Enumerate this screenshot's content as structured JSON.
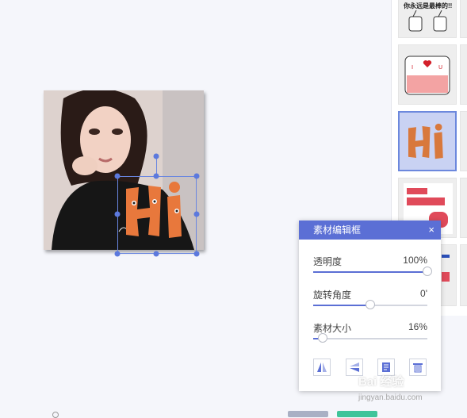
{
  "editor": {
    "title": "素材编辑框",
    "close_symbol": "×",
    "sliders": [
      {
        "label": "透明度",
        "value_text": "100%",
        "level": 1.0
      },
      {
        "label": "旋转角度",
        "value_text": "0'",
        "level": 0.5
      },
      {
        "label": "素材大小",
        "value_text": "16%",
        "level": 0.08
      }
    ],
    "tools": [
      {
        "icon": "flip-horizontal-icon"
      },
      {
        "icon": "flip-vertical-icon"
      },
      {
        "icon": "copy-layer-icon"
      },
      {
        "icon": "delete-icon"
      }
    ]
  },
  "sticker_panel": {
    "top_sticker_text": "你永远是最棒的!!",
    "stickers": [
      {
        "icon": "thumbs-up-sticker",
        "selected": false
      },
      {
        "icon": "i-love-u-sticker",
        "selected": false
      },
      {
        "icon": "hi-sticker",
        "selected": true
      },
      {
        "icon": "its-monday-ok-sticker",
        "selected": false
      }
    ]
  },
  "canvas": {
    "sticker_on_photo": "hi-sticker"
  },
  "watermark": {
    "logo_text": "Bai 经验",
    "url": "jingyan.baidu.com"
  },
  "colors": {
    "accent": "#5b6fd5",
    "selection": "#6a86e0",
    "green_button": "#3fc49a",
    "sticker_orange": "#e8783c"
  }
}
